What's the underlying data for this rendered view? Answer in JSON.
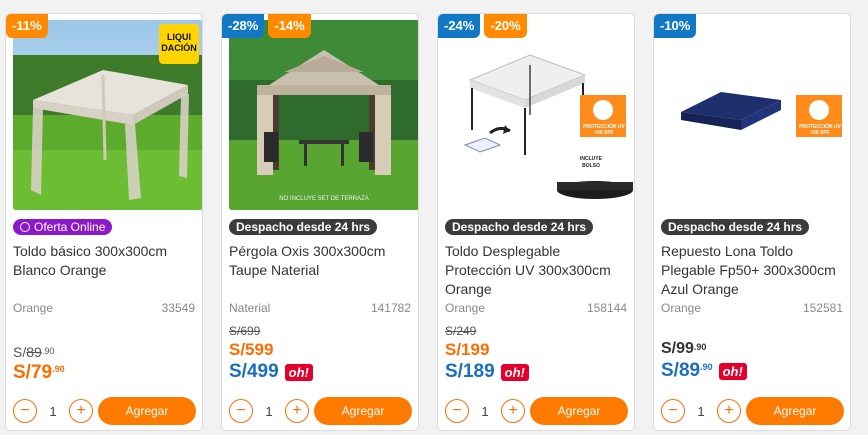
{
  "products": [
    {
      "badges": [
        "-11%"
      ],
      "tag": "Oferta Online",
      "title": "Toldo básico 300x300cm Blanco Orange",
      "brand": "Orange",
      "sku": "33549",
      "old_price_prefix": "S/",
      "old_price": "89",
      "old_price_cents": ".90",
      "price_prefix": "S/",
      "price": "79",
      "price_cents": ".90",
      "qty": "1",
      "add_label": "Agregar",
      "image_badge": "LIQUI DACIÓN"
    },
    {
      "badges": [
        "-28%",
        "-14%"
      ],
      "tag": "Despacho desde 24 hrs",
      "title": "Pérgola Oxis 300x300cm Taupe Naterial",
      "brand": "Naterial",
      "sku": "141782",
      "old_price": "S/699",
      "price_orange": "S/599",
      "price_blue": "S/499",
      "oh": "oh!",
      "qty": "1",
      "add_label": "Agregar",
      "image_caption": "NO INCLUYE SET DE TERRAZA"
    },
    {
      "badges": [
        "-24%",
        "-20%"
      ],
      "tag": "Despacho desde 24 hrs",
      "title": "Toldo Desplegable Protección UV 300x300cm Orange",
      "brand": "Orange",
      "sku": "158144",
      "old_price": "S/249",
      "price_orange": "S/199",
      "price_blue": "S/189",
      "oh": "oh!",
      "qty": "1",
      "add_label": "Agregar",
      "image_label1": "PROTECCIÓN UV +50 SPF",
      "image_label2": "INCLUYE BOLSO"
    },
    {
      "badges": [
        "-10%"
      ],
      "tag": "Despacho desde 24 hrs",
      "title": "Repuesto Lona Toldo Plegable Fp50+ 300x300cm Azul Orange",
      "brand": "Orange",
      "sku": "152581",
      "dark_prefix": "S/",
      "dark_price": "99",
      "dark_cents": ".90",
      "blue_prefix": "S/",
      "blue_price": "89",
      "blue_cents": ".90",
      "oh": "oh!",
      "qty": "1",
      "add_label": "Agregar",
      "image_label1": "PROTECCIÓN UV +50 SPF"
    }
  ],
  "icons": {
    "minus": "−",
    "plus": "+"
  },
  "colors": {
    "orange": "#ff7b00",
    "blue": "#1178c6",
    "oh_red": "#e4002b",
    "purple": "#8b18c9"
  }
}
